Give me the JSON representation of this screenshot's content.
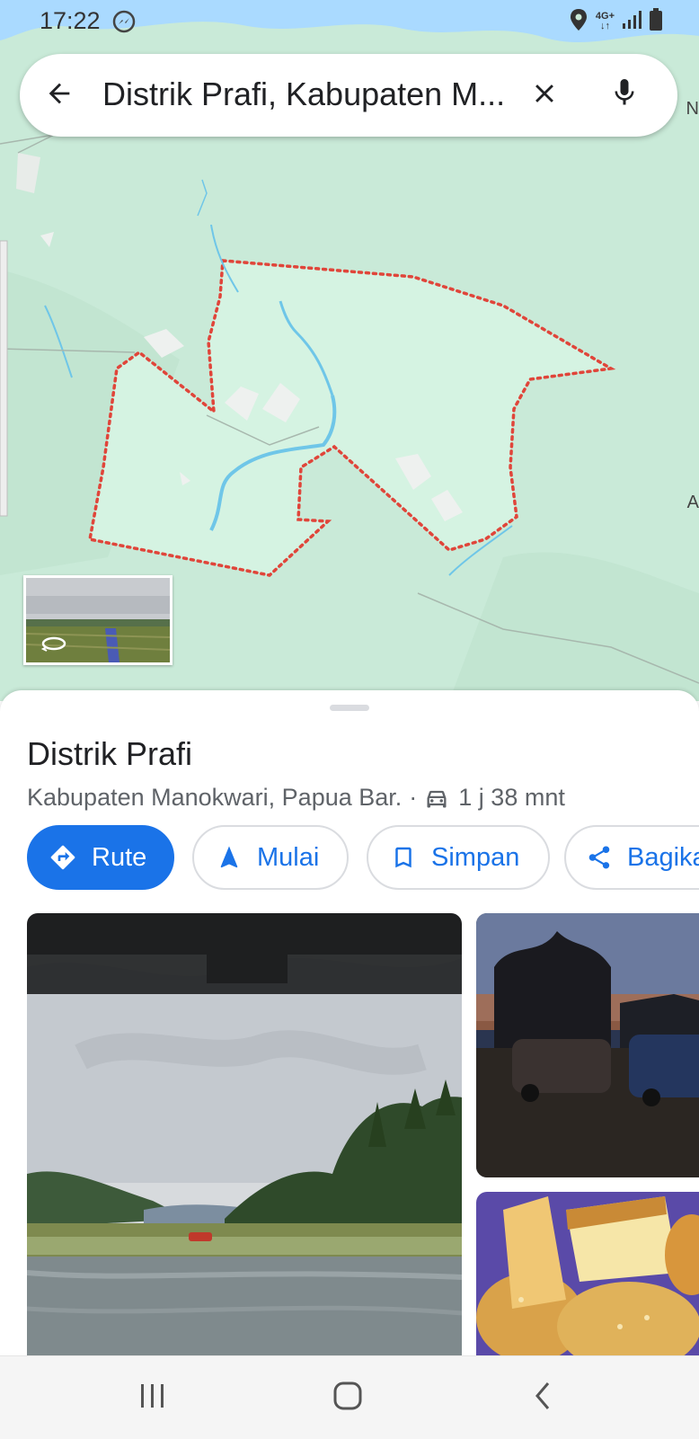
{
  "status_bar": {
    "time": "17:22",
    "left_icon": "messenger-icon",
    "right_icons": [
      "location-icon",
      "network-4g-icon",
      "signal-icon",
      "battery-icon"
    ],
    "network_label_top": "4G+",
    "network_label_bottom": "↓↑"
  },
  "search": {
    "query": "Distrik Prafi, Kabupaten M...",
    "back_icon": "arrow-back-icon",
    "clear_icon": "close-icon",
    "voice_icon": "microphone-icon"
  },
  "map": {
    "edge_label_right_top": "N",
    "edge_label_right_mid": "A",
    "boundary_color": "#e0453a",
    "water_color": "#6fc6e8",
    "land_color": "#c9ead8",
    "region_fill": "#d5f3e2",
    "street_view_icon": "360-rotate-icon"
  },
  "place": {
    "title": "Distrik Prafi",
    "location": "Kabupaten Manokwari, Papua Bar.",
    "separator": "·",
    "travel_icon": "car-icon",
    "travel_time": "1 j 38 mnt"
  },
  "actions": [
    {
      "label": "Rute",
      "icon": "directions-icon"
    },
    {
      "label": "Mulai",
      "icon": "navigation-arrow-icon"
    },
    {
      "label": "Simpan",
      "icon": "bookmark-icon"
    },
    {
      "label": "Bagikan",
      "icon": "share-icon"
    }
  ],
  "nav_bar": {
    "recents_icon": "recents-icon",
    "home_icon": "home-icon",
    "back_icon": "back-chevron-icon"
  },
  "colors": {
    "accent": "#1a73e8",
    "text_primary": "#202124",
    "text_secondary": "#5f6368"
  }
}
